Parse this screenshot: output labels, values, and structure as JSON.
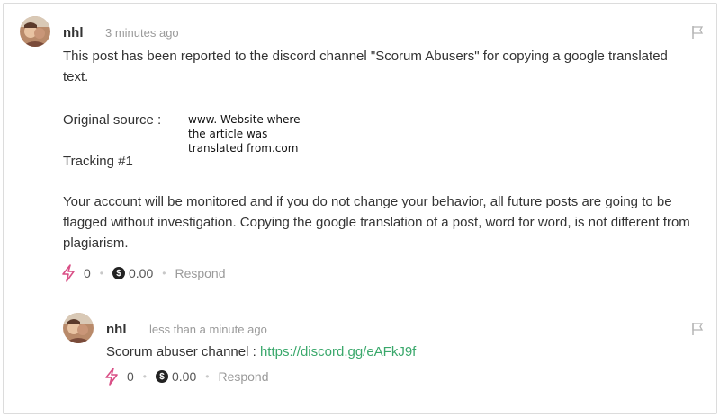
{
  "comments": [
    {
      "author": "nhl",
      "time": "3 minutes ago",
      "paragraph1": "This post has been reported to the discord channel \"Scorum Abusers\" for copying a google translated text.",
      "source_label": "Original source :",
      "source_note_lines": [
        "www. Website where",
        "the article was",
        "translated from.com"
      ],
      "tracking": "Tracking #1",
      "paragraph2": "Your account will be monitored and if you do not change your behavior, all future posts are going to be flagged without investigation. Copying the google translation of a post, word for word, is not different from plagiarism.",
      "votes": "0",
      "payout": "0.00",
      "respond_label": "Respond"
    },
    {
      "author": "nhl",
      "time": "less than a minute ago",
      "text_prefix": "Scorum abuser channel : ",
      "link_text": "https://discord.gg/eAFkJ9f",
      "votes": "0",
      "payout": "0.00",
      "respond_label": "Respond"
    }
  ],
  "icons": {
    "vote": "lightning-bolt-icon",
    "payout": "dollar-coin-icon",
    "flag": "flag-icon"
  },
  "colors": {
    "accent_link": "#3aa86b",
    "bolt": "#d94f86",
    "muted_text": "#9a9a9a"
  },
  "separator": "•",
  "coin_symbol": "$"
}
